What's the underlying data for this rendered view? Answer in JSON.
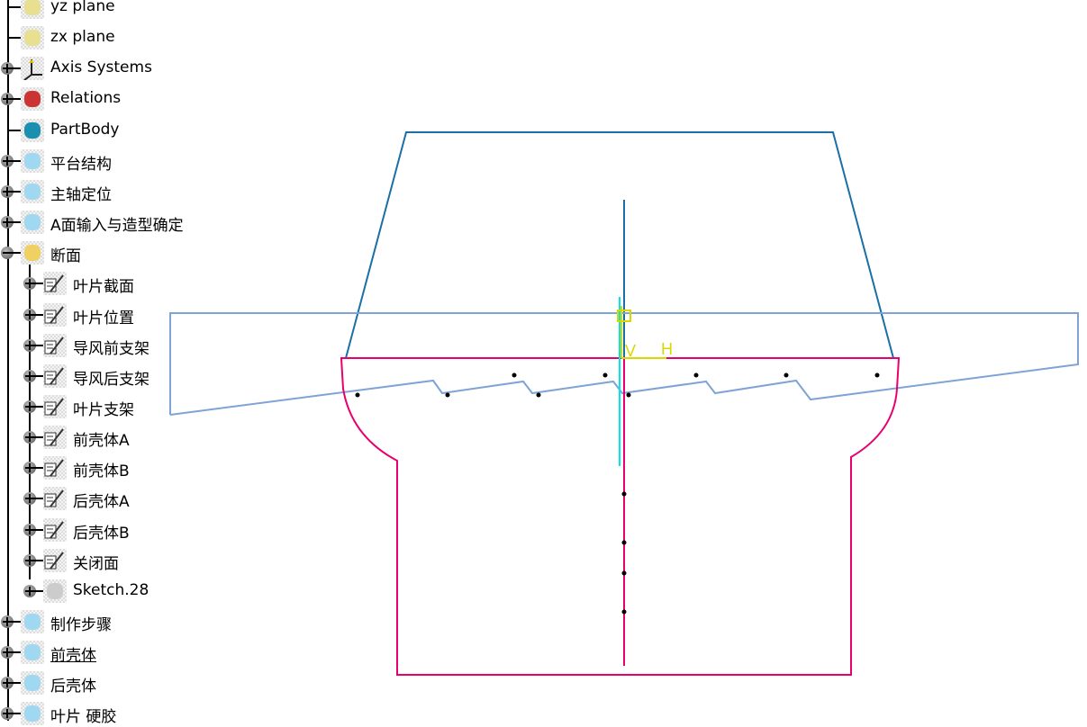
{
  "tree": {
    "items": [
      {
        "label": "yz plane",
        "level": 0,
        "expander": "none",
        "icon": "plane-icon"
      },
      {
        "label": "zx plane",
        "level": 0,
        "expander": "none",
        "icon": "plane-icon"
      },
      {
        "label": "Axis Systems",
        "level": 0,
        "expander": "plus",
        "icon": "axis-system-icon"
      },
      {
        "label": "Relations",
        "level": 0,
        "expander": "plus",
        "icon": "relations-icon"
      },
      {
        "label": "PartBody",
        "level": 0,
        "expander": "none",
        "icon": "partbody-gear-icon"
      },
      {
        "label": "平台结构",
        "level": 0,
        "expander": "plus",
        "icon": "geometrical-set-icon"
      },
      {
        "label": "主轴定位",
        "level": 0,
        "expander": "plus",
        "icon": "geometrical-set-icon"
      },
      {
        "label": "A面输入与造型确定",
        "level": 0,
        "expander": "plus",
        "icon": "geometrical-set-icon"
      },
      {
        "label": "断面",
        "level": 0,
        "expander": "minus",
        "icon": "geometrical-set-open-icon"
      },
      {
        "label": "叶片截面",
        "level": 1,
        "expander": "plus",
        "icon": "sketch-icon"
      },
      {
        "label": "叶片位置",
        "level": 1,
        "expander": "plus",
        "icon": "sketch-icon"
      },
      {
        "label": "导风前支架",
        "level": 1,
        "expander": "plus",
        "icon": "sketch-icon"
      },
      {
        "label": "导风后支架",
        "level": 1,
        "expander": "plus",
        "icon": "sketch-icon"
      },
      {
        "label": "叶片支架",
        "level": 1,
        "expander": "plus",
        "icon": "sketch-icon"
      },
      {
        "label": "前壳体A",
        "level": 1,
        "expander": "plus",
        "icon": "sketch-icon"
      },
      {
        "label": "前壳体B",
        "level": 1,
        "expander": "plus",
        "icon": "sketch-icon"
      },
      {
        "label": "后壳体A",
        "level": 1,
        "expander": "plus",
        "icon": "sketch-icon"
      },
      {
        "label": "后壳体B",
        "level": 1,
        "expander": "plus",
        "icon": "sketch-icon"
      },
      {
        "label": "关闭面",
        "level": 1,
        "expander": "plus",
        "icon": "sketch-icon"
      },
      {
        "label": "Sketch.28",
        "level": 1,
        "expander": "plus",
        "icon": "sketch-grid-icon"
      },
      {
        "label": "制作步骤",
        "level": 0,
        "expander": "plus",
        "icon": "geometrical-set-icon"
      },
      {
        "label": "前壳体",
        "level": 0,
        "expander": "plus",
        "icon": "geometrical-set-icon",
        "underlined": true
      },
      {
        "label": "后壳体",
        "level": 0,
        "expander": "plus",
        "icon": "geometrical-set-icon"
      },
      {
        "label": "叶片 硬胶",
        "level": 0,
        "expander": "plus",
        "icon": "geometrical-set-icon"
      }
    ]
  },
  "viewer": {
    "axis_labels": {
      "v": "V",
      "h": "H"
    },
    "colors": {
      "profile": "#e8006e",
      "trapezoid": "#1a6fa8",
      "blade": "#7fa3d6",
      "axis": "#e0e000",
      "cyan": "#00e5ee"
    }
  }
}
